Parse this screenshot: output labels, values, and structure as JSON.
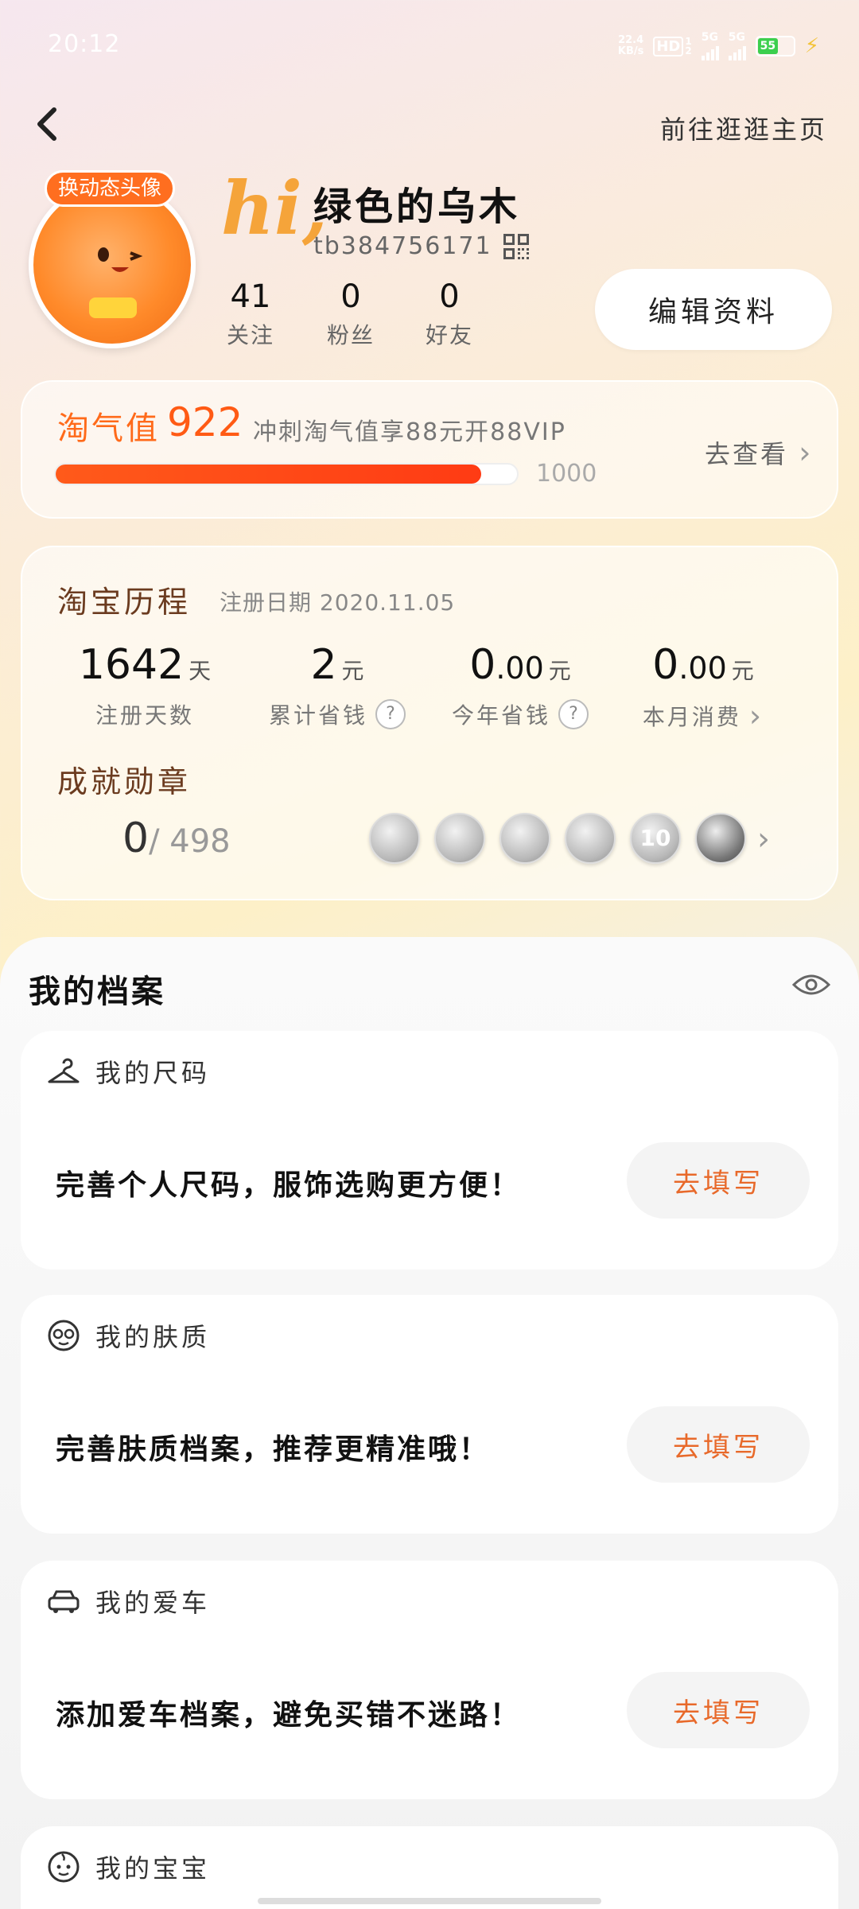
{
  "status_bar": {
    "time": "20:12",
    "net_speed_top": "22.4",
    "net_speed_bottom": "KB/s",
    "hd_label": "HD",
    "sim1": "1",
    "sim2": "2",
    "sig1_label": "5G",
    "sig2_label": "5G",
    "battery": "55"
  },
  "header": {
    "visit_homepage": "前往逛逛主页"
  },
  "profile": {
    "avatar_badge": "换动态头像",
    "greeting": "hi,",
    "username": "绿色的乌木",
    "account_id": "tb384756171",
    "stats": [
      {
        "value": "41",
        "label": "关注"
      },
      {
        "value": "0",
        "label": "粉丝"
      },
      {
        "value": "0",
        "label": "好友"
      }
    ],
    "edit_button": "编辑资料"
  },
  "taoqi": {
    "label": "淘气值",
    "value": "922",
    "promo": "冲刺淘气值享88元开88VIP",
    "max": "1000",
    "progress": 0.922,
    "view": "去查看"
  },
  "journey": {
    "title": "淘宝历程",
    "register": "注册日期 2020.11.05",
    "stats": [
      {
        "int": "1642",
        "dec": "",
        "unit": "天",
        "label": "注册天数"
      },
      {
        "int": "2",
        "dec": "",
        "unit": "元",
        "label": "累计省钱"
      },
      {
        "int": "0",
        "dec": ".00",
        "unit": "元",
        "label": "今年省钱"
      },
      {
        "int": "0",
        "dec": ".00",
        "unit": "元",
        "label": "本月消费"
      }
    ],
    "help": "?",
    "badges_title": "成就勋章",
    "badges_earned": "0",
    "badges_total": "/ 498",
    "medal_10": "10"
  },
  "archive": {
    "title": "我的档案",
    "cards": [
      {
        "title": "我的尺码",
        "text": "完善个人尺码，服饰选购更方便！",
        "button": "去填写"
      },
      {
        "title": "我的肤质",
        "text": "完善肤质档案，推荐更精准哦！",
        "button": "去填写"
      },
      {
        "title": "我的爱车",
        "text": "添加爱车档案，避免买错不迷路！",
        "button": "去填写"
      },
      {
        "title": "我的宝宝"
      }
    ]
  },
  "colors": {
    "accent": "#ff5a14",
    "fill_button_text": "#e8692a"
  }
}
